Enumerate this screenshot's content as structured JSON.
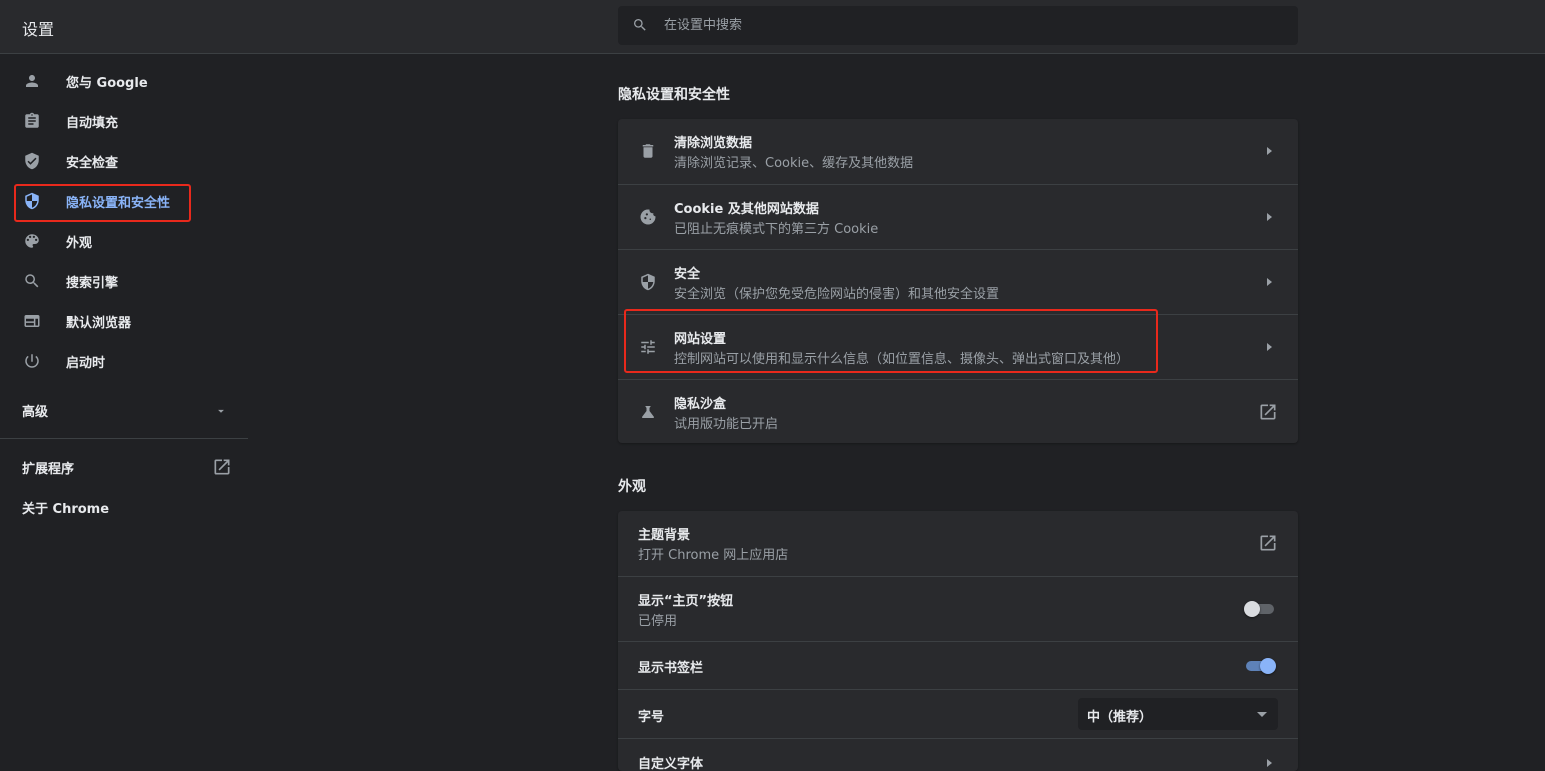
{
  "header": {
    "title": "设置",
    "search_placeholder": "在设置中搜索"
  },
  "sidebar": {
    "items": [
      {
        "label": "您与 Google",
        "icon": "person-icon"
      },
      {
        "label": "自动填充",
        "icon": "clipboard-icon"
      },
      {
        "label": "安全检查",
        "icon": "shield-check-icon"
      },
      {
        "label": "隐私设置和安全性",
        "icon": "privacy-shield-icon",
        "active": true
      },
      {
        "label": "外观",
        "icon": "palette-icon"
      },
      {
        "label": "搜索引擎",
        "icon": "search-icon"
      },
      {
        "label": "默认浏览器",
        "icon": "browser-window-icon"
      },
      {
        "label": "启动时",
        "icon": "power-icon"
      }
    ],
    "advanced_label": "高级",
    "extensions_label": "扩展程序",
    "about_label": "关于 Chrome"
  },
  "privacy": {
    "section_title": "隐私设置和安全性",
    "rows": [
      {
        "title": "清除浏览数据",
        "subtitle": "清除浏览记录、Cookie、缓存及其他数据",
        "icon": "trash-icon"
      },
      {
        "title": "Cookie 及其他网站数据",
        "subtitle": "已阻止无痕模式下的第三方 Cookie",
        "icon": "cookie-icon"
      },
      {
        "title": "安全",
        "subtitle": "安全浏览（保护您免受危险网站的侵害）和其他安全设置",
        "icon": "shield-half-icon"
      },
      {
        "title": "网站设置",
        "subtitle": "控制网站可以使用和显示什么信息（如位置信息、摄像头、弹出式窗口及其他）",
        "icon": "tune-icon"
      },
      {
        "title": "隐私沙盒",
        "subtitle": "试用版功能已开启",
        "icon": "flask-icon"
      }
    ]
  },
  "appearance": {
    "section_title": "外观",
    "theme": {
      "title": "主题背景",
      "subtitle": "打开 Chrome 网上应用店"
    },
    "home_button": {
      "title": "显示“主页”按钮",
      "subtitle": "已停用",
      "enabled": false
    },
    "bookmarks_bar": {
      "title": "显示书签栏",
      "enabled": true
    },
    "font_size": {
      "title": "字号",
      "value": "中（推荐）"
    },
    "custom_fonts": {
      "title": "自定义字体"
    }
  },
  "colors": {
    "accent": "#8ab4f8",
    "highlight": "#e8291c",
    "background": "#202124",
    "card": "#292a2d"
  }
}
